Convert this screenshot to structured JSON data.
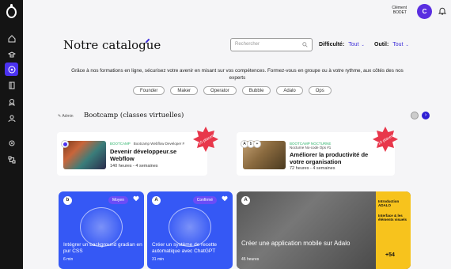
{
  "user": {
    "first_name": "Clément",
    "last_name": "BODET",
    "initial": "C"
  },
  "page": {
    "title": "Notre catalogue"
  },
  "search": {
    "placeholder": "Rechercher"
  },
  "filters": {
    "difficulty_label": "Difficulté:",
    "difficulty_value": "Tout",
    "tool_label": "Outil:",
    "tool_value": "Tout"
  },
  "intro": "Grâce à nos formations en ligne, sécurisez votre avenir en misant sur vos compétences. Formez-vous en groupe ou à votre rythme, aux côtés des nos experts",
  "chips": [
    "Founder",
    "Maker",
    "Operator",
    "Bubble",
    "Adalo",
    "Ops"
  ],
  "section": {
    "admin": "Admin",
    "title": "Bootcamp (classes virtuelles)"
  },
  "bootcamps": [
    {
      "tag": "BOOTCAMP",
      "subtag": "Bootcamp Webflow Developer #",
      "title": "Devenir développeur.se Webflow",
      "meta": "140 heures - 4 semaines",
      "badge": "10 places",
      "accent": "#2db36b"
    },
    {
      "tag": "BOOTCAMP NOCTURNE",
      "subtag": "Nocturne No-code Ops #1",
      "title": "Améliorer la productivité de votre organisation",
      "meta": "72 heures - 4 semaines",
      "badge": "10 places",
      "accent": "#2db36b"
    }
  ],
  "courses": [
    {
      "logo": "b",
      "level": "Moyen",
      "title": "Intégrer un background gradian en pur CSS",
      "meta": "6 min"
    },
    {
      "logo": "A",
      "level": "Confirmé",
      "title": "Créer un système de recette automatique avec ChatGPT",
      "meta": "31 min"
    }
  ],
  "featured": {
    "logo": "A",
    "title": "Créer une application mobile sur Adalo",
    "meta": "45 heures",
    "panel_title": "Introduction ADALO",
    "panel_sub": "Interface & les éléments visuels",
    "panel_count": "+54"
  },
  "colors": {
    "accent": "#4b32f0",
    "badge": "#e8374b",
    "card_blue": "#3558f5",
    "panel_yellow": "#f7c31d"
  }
}
